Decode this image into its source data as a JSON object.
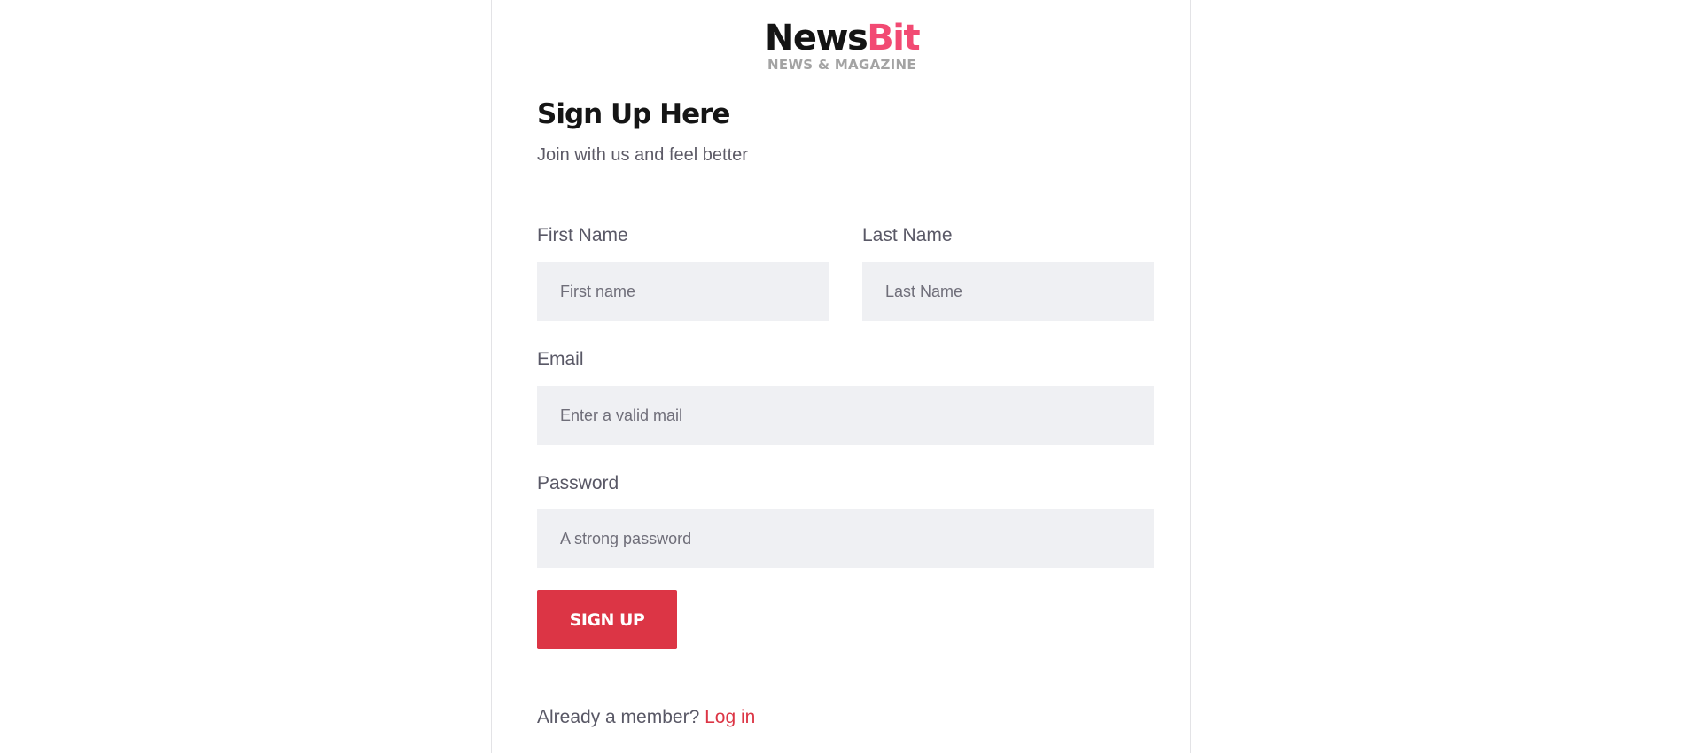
{
  "brand": {
    "name_part1": "News",
    "name_part2": "Bit",
    "tagline": "NEWS & MAGAZINE",
    "accent_color": "#f24a73"
  },
  "heading": {
    "title": "Sign Up Here",
    "subtitle": "Join with us and feel better"
  },
  "form": {
    "first_name": {
      "label": "First Name",
      "placeholder": "First name",
      "value": ""
    },
    "last_name": {
      "label": "Last Name",
      "placeholder": "Last Name",
      "value": ""
    },
    "email": {
      "label": "Email",
      "placeholder": "Enter a valid mail",
      "value": ""
    },
    "password": {
      "label": "Password",
      "placeholder": "A strong password",
      "value": ""
    },
    "submit_label": "SIGN UP",
    "submit_color": "#dc3545"
  },
  "footer": {
    "prompt": "Already a member?",
    "link_label": "Log in"
  }
}
